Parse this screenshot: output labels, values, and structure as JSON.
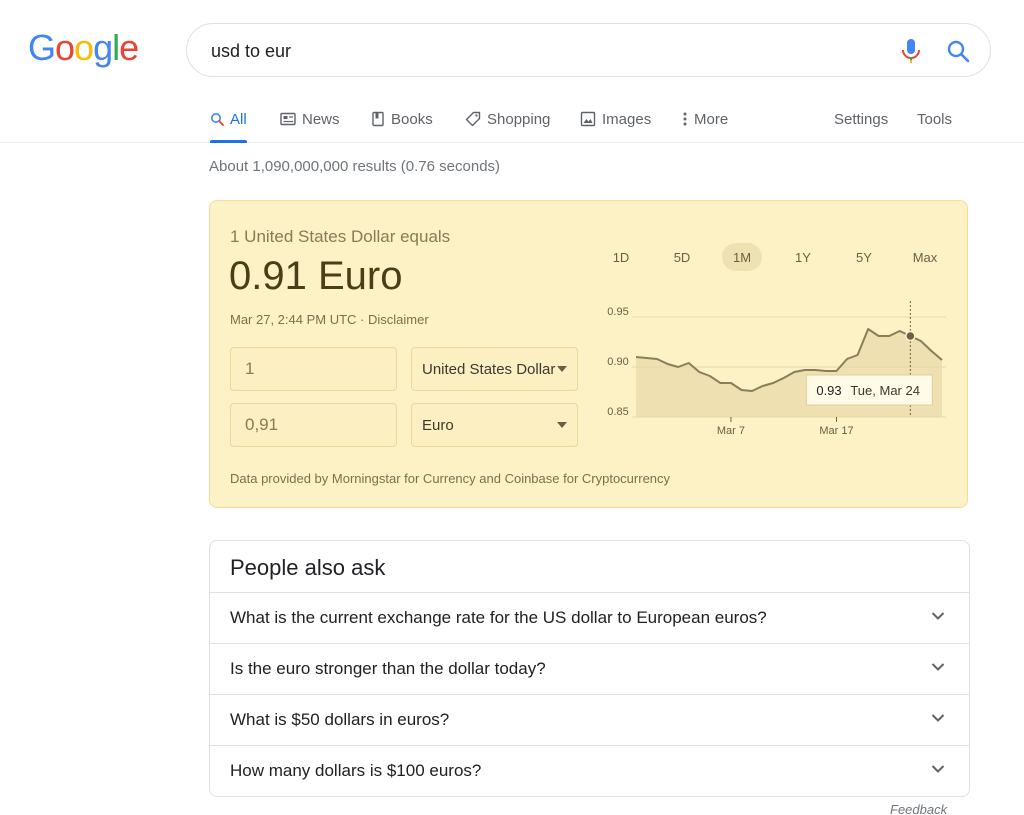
{
  "logo": {
    "letters": [
      "G",
      "o",
      "o",
      "g",
      "l",
      "e"
    ],
    "colors": [
      "#4285F4",
      "#EA4335",
      "#FBBC05",
      "#4285F4",
      "#34A853",
      "#EA4335"
    ]
  },
  "search": {
    "query": "usd to eur",
    "mic_icon": "mic-icon",
    "search_icon": "search-icon"
  },
  "tabs": [
    {
      "label": "All",
      "icon": "search-icon",
      "active": true
    },
    {
      "label": "News",
      "icon": "news-icon"
    },
    {
      "label": "Books",
      "icon": "book-icon"
    },
    {
      "label": "Shopping",
      "icon": "tag-icon"
    },
    {
      "label": "Images",
      "icon": "image-icon"
    },
    {
      "label": "More",
      "icon": "kebab-icon"
    }
  ],
  "tools": {
    "settings": "Settings",
    "tools": "Tools"
  },
  "stats": "About 1,090,000,000 results (0.76 seconds)",
  "converter": {
    "equals_label": "1 United States Dollar equals",
    "result": "0.91 Euro",
    "timestamp": "Mar 27, 2:44 PM UTC · Disclaimer",
    "from_amount": "1",
    "from_currency": "United States Dollar",
    "to_amount": "0,91",
    "to_currency": "Euro",
    "provider": "Data provided by Morningstar for Currency and Coinbase for Cryptocurrency",
    "ranges": [
      "1D",
      "5D",
      "1M",
      "1Y",
      "5Y",
      "Max"
    ],
    "active_range": "1M",
    "colors": {
      "card_bg": "#fdf1c6",
      "line": "#8a7d5c",
      "fill": "#e8d9a8"
    }
  },
  "chart_data": {
    "type": "area",
    "x": [
      "Feb 26",
      "Feb 27",
      "Feb 28",
      "Mar 1",
      "Mar 2",
      "Mar 3",
      "Mar 4",
      "Mar 5",
      "Mar 6",
      "Mar 7",
      "Mar 8",
      "Mar 9",
      "Mar 10",
      "Mar 11",
      "Mar 12",
      "Mar 13",
      "Mar 14",
      "Mar 15",
      "Mar 16",
      "Mar 17",
      "Mar 18",
      "Mar 19",
      "Mar 20",
      "Mar 21",
      "Mar 22",
      "Mar 23",
      "Mar 24",
      "Mar 25",
      "Mar 26",
      "Mar 27"
    ],
    "values": [
      0.91,
      0.909,
      0.908,
      0.903,
      0.9,
      0.904,
      0.895,
      0.891,
      0.884,
      0.884,
      0.877,
      0.876,
      0.881,
      0.884,
      0.889,
      0.895,
      0.897,
      0.897,
      0.896,
      0.896,
      0.908,
      0.912,
      0.938,
      0.931,
      0.931,
      0.936,
      0.931,
      0.926,
      0.916,
      0.907
    ],
    "yticks": [
      0.95,
      0.9,
      0.85
    ],
    "ylim": [
      0.85,
      0.95
    ],
    "xtick_labels": [
      "Mar 7",
      "Mar 17"
    ],
    "tooltip": {
      "value": "0.93",
      "date": "Tue, Mar 24"
    },
    "highlight_index": 26,
    "grid": true
  },
  "people_also_ask": {
    "title": "People also ask",
    "questions": [
      "What is the current exchange rate for the US dollar to European euros?",
      "Is the euro stronger than the dollar today?",
      "What is $50 dollars in euros?",
      "How many dollars is $100 euros?"
    ]
  },
  "feedback": "Feedback"
}
